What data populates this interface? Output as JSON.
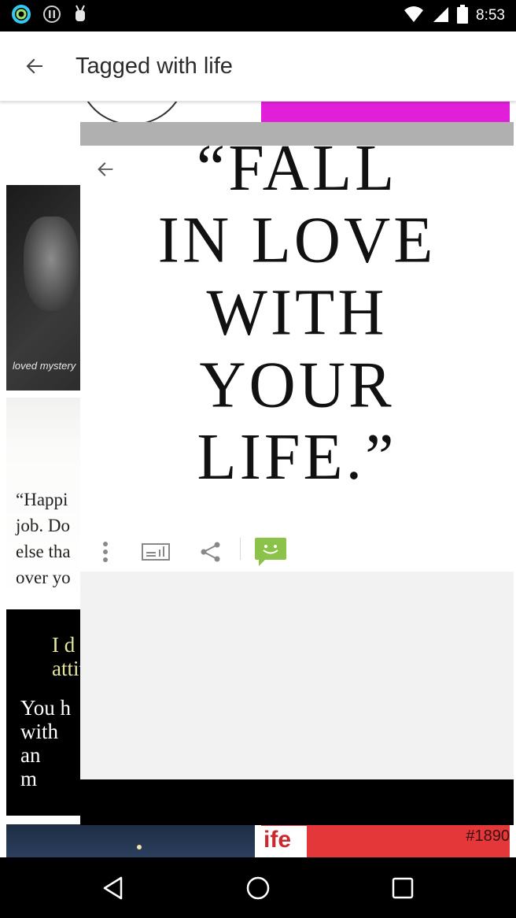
{
  "status_bar": {
    "time": "8:53",
    "icons": [
      "ring-app-icon",
      "info-circle-icon",
      "android-debug-icon",
      "wifi-icon",
      "signal-icon",
      "battery-icon"
    ]
  },
  "app_bar": {
    "title": "Tagged with life",
    "back_icon": "arrow-back-icon"
  },
  "grid": {
    "tiles": [
      {
        "id": "top-left",
        "caption": ""
      },
      {
        "id": "top-right",
        "color": "#e11fd9"
      },
      {
        "id": "girl",
        "caption": "loved mystery"
      },
      {
        "id": "happiness-quote",
        "text": "“Happi\njob. Do\nelse tha\nover yo"
      },
      {
        "id": "attitude-quote",
        "yellow_text": "I d\nattit",
        "white_text": "You h\nwith\nan\nm"
      },
      {
        "id": "bottom-left",
        "color": "#1e2d44"
      },
      {
        "id": "bottom-right",
        "text": "ife",
        "tag": "#1890"
      }
    ]
  },
  "viewer": {
    "quote": "“FALL\nIN LOVE\nWITH\nYOUR\nLIFE.”",
    "back_icon": "arrow-back-icon",
    "toolbar": {
      "items": [
        "more-vert-icon",
        "set-wallpaper-icon",
        "share-icon",
        "chat-smiley-icon"
      ],
      "accent": "#8bc34a"
    }
  },
  "nav_bar": {
    "items": [
      "back-triangle-icon",
      "home-circle-icon",
      "recents-square-icon"
    ]
  }
}
